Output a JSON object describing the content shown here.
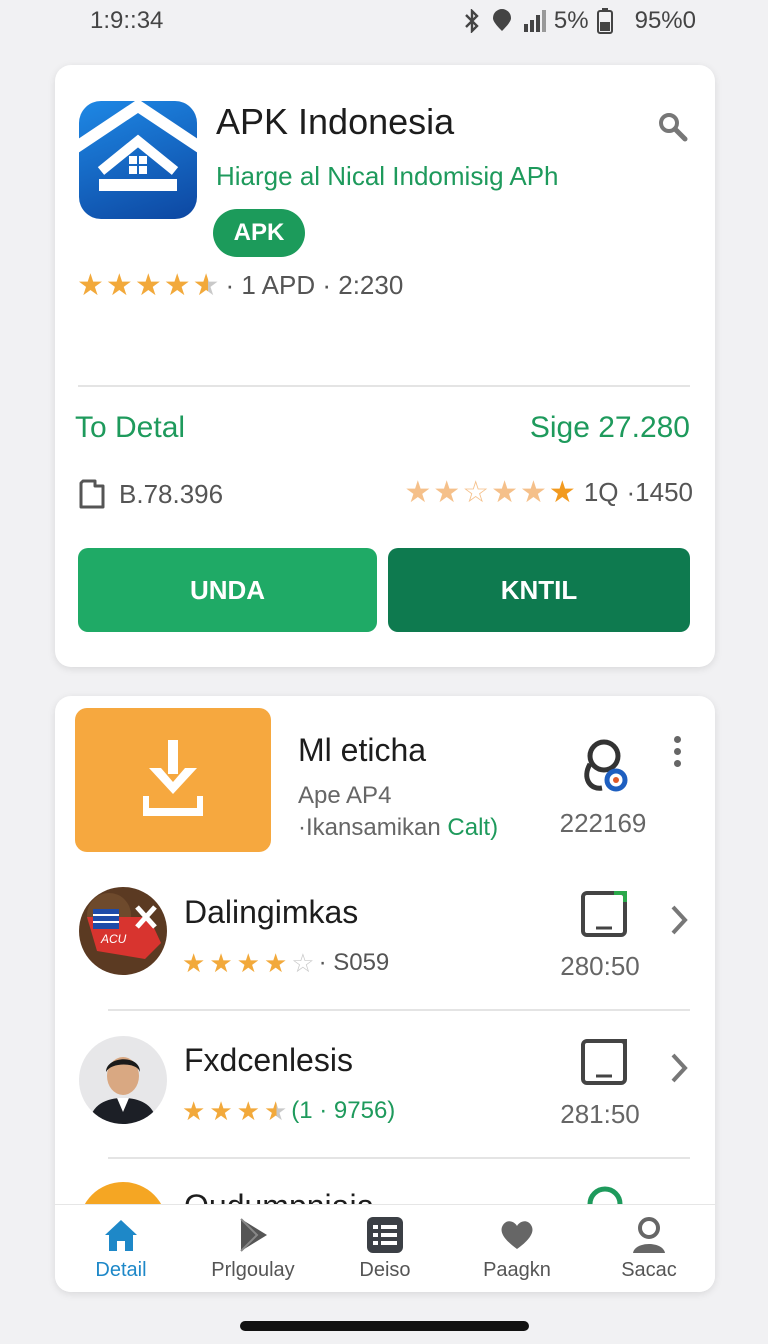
{
  "status_bar": {
    "time": "1:9::34",
    "battery_text": "5%",
    "right_text": "95%0"
  },
  "app": {
    "title": "APK Indonesia",
    "subtitle": "Hiarge al Nical Indomisig APh",
    "badge": "APK",
    "rating_text": "· 1 APD · 2:230",
    "rating_stars": 4.5
  },
  "details": {
    "link_label": "To Detal",
    "size_label": "Sige 27.280",
    "storage_value": "B.78.396",
    "review_count": "1Q",
    "review_total": "·1450"
  },
  "actions": {
    "primary_label": "UNDA",
    "secondary_label": "KNTIL"
  },
  "list": {
    "featured": {
      "title": "Ml eticha",
      "sub1": "Ape AP4",
      "sub2_prefix": "·Ikansamikan ",
      "sub2_green": "Calt)",
      "meta": "222169"
    },
    "items": [
      {
        "title": "Dalingimkas",
        "rating_text": "· S059",
        "rating_stars": 4,
        "meta": "280:50"
      },
      {
        "title": "Fxdcenlesis",
        "rating_text": "(1 · 9756)",
        "rating_stars": 3.5,
        "meta": "281:50"
      },
      {
        "title": "Oudumpniaia"
      }
    ]
  },
  "bottom_nav": [
    {
      "label": "Detail",
      "icon": "home-icon",
      "active": true
    },
    {
      "label": "Prlgoulay",
      "icon": "play-icon",
      "active": false
    },
    {
      "label": "Deiso",
      "icon": "list-icon",
      "active": false
    },
    {
      "label": "Paagkn",
      "icon": "heart-icon",
      "active": false
    },
    {
      "label": "Sacac",
      "icon": "person-icon",
      "active": false
    }
  ],
  "colors": {
    "accent_green": "#1e9a5c",
    "button_green": "#1faa66",
    "button_dark_green": "#0e7a4f",
    "star": "#f2a93b",
    "tile_orange": "#f6a83f",
    "nav_active": "#1e88c8"
  }
}
